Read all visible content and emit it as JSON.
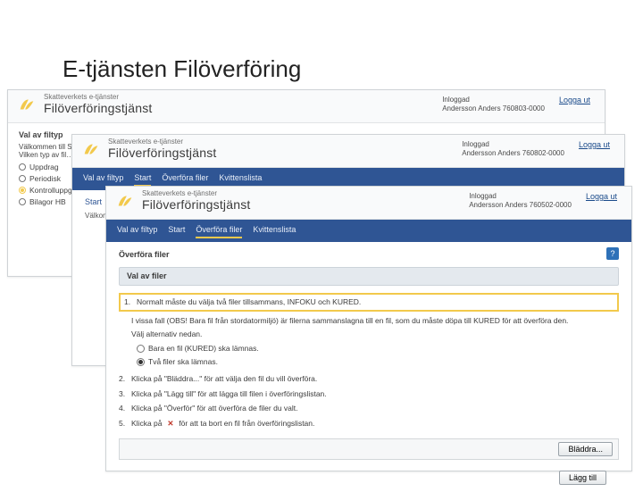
{
  "slide_title": "E-tjänsten Filöverföring",
  "brand": {
    "sup": "Skatteverkets e-tjänster",
    "main": "Filöverföringstjänst"
  },
  "login": {
    "label": "Inloggad",
    "user": "Andersson Anders 760803-0000"
  },
  "login2": {
    "label": "Inloggad",
    "user": "Andersson Anders 760802-0000"
  },
  "login3": {
    "label": "Inloggad",
    "user": "Andersson Anders 760502-0000"
  },
  "logout_label": "Logga ut",
  "tabs": [
    "Val av filtyp",
    "Start",
    "Överföra filer",
    "Kvittenslista"
  ],
  "w1": {
    "head": "Val av filtyp",
    "line1": "Välkommen till Skatteverkets filöverföringstjänst.",
    "line2": "Vilken typ av fil…",
    "options": [
      "Uppdrag",
      "Periodisk",
      "Kontrolluppgifter",
      "Bilagor HB"
    ]
  },
  "w2": {
    "start_label": "Start",
    "welcome": "Välkommen"
  },
  "w3": {
    "heading": "Överföra filer",
    "sublabel": "Val av filer",
    "step1": "Normalt måste du välja två filer tillsammans, INFOKU och KURED.",
    "step1b": "I vissa fall (OBS! Bara fil från stordatormiljö) är filerna sammanslagna till en fil, som du måste döpa till KURED för att överföra den.",
    "choose_label": "Välj alternativ nedan.",
    "radio1": "Bara en fil (KURED) ska lämnas.",
    "radio2": "Två filer ska lämnas.",
    "step2": "Klicka på \"Bläddra...\" för att välja den fil du vill överföra.",
    "step3": "Klicka på \"Lägg till\" för att lägga till filen i överföringslistan.",
    "step4": "Klicka på \"Överför\" för att överföra de filer du valt.",
    "step5_pre": "Klicka på",
    "step5_post": "för att ta bort en fil från överföringslistan.",
    "browse_btn": "Bläddra...",
    "add_btn": "Lägg till"
  }
}
